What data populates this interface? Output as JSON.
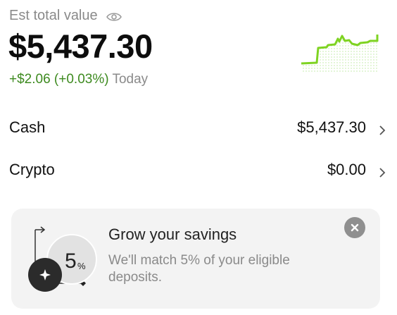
{
  "header": {
    "label": "Est total value",
    "icon": "eye-icon"
  },
  "balance": {
    "total": "$5,437.30",
    "change": "+$2.06 (+0.03%)",
    "period": "Today",
    "accent_color": "#3d8a1f"
  },
  "accounts": [
    {
      "label": "Cash",
      "value": "$5,437.30"
    },
    {
      "label": "Crypto",
      "value": "$0.00"
    }
  ],
  "promo": {
    "title": "Grow your savings",
    "text": "We'll match 5% of your eligible deposits.",
    "badge_number": "5",
    "badge_unit": "%"
  }
}
